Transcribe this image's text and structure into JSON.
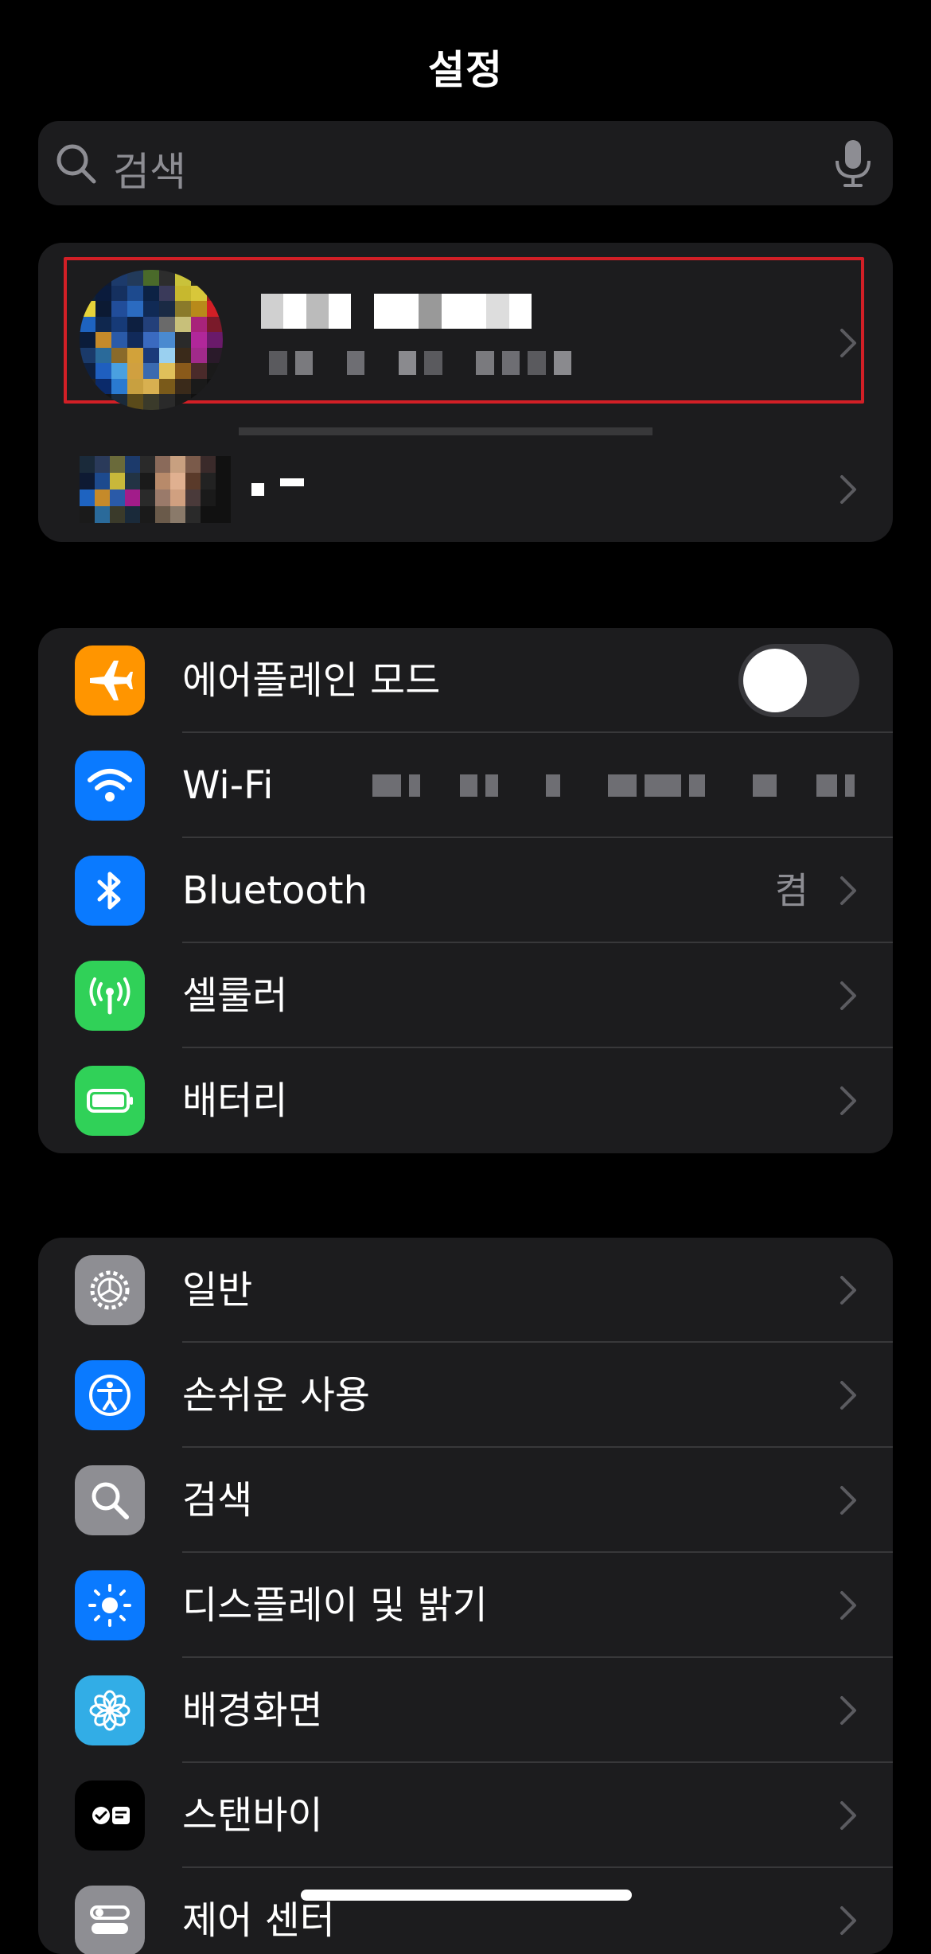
{
  "header": {
    "title": "설정"
  },
  "search": {
    "placeholder": "검색",
    "icons": [
      "search-icon",
      "mic-icon"
    ]
  },
  "account": {
    "primary_name": "",
    "secondary_name": ""
  },
  "connectivity": {
    "items": [
      {
        "label": "에어플레인 모드",
        "icon": "airplane-icon",
        "color": "#ff9500",
        "toggle": false
      },
      {
        "label": "Wi-Fi",
        "icon": "wifi-icon",
        "color": "#0a7aff",
        "value": ""
      },
      {
        "label": "Bluetooth",
        "icon": "bluetooth-icon",
        "color": "#0a7aff",
        "value": "켬"
      },
      {
        "label": "셀룰러",
        "icon": "cellular-icon",
        "color": "#30d158"
      },
      {
        "label": "배터리",
        "icon": "battery-icon",
        "color": "#30d158"
      }
    ]
  },
  "general": {
    "items": [
      {
        "label": "일반",
        "icon": "gear-icon",
        "color": "#8e8e93"
      },
      {
        "label": "손쉬운 사용",
        "icon": "accessibility-icon",
        "color": "#0a7aff"
      },
      {
        "label": "검색",
        "icon": "search-icon",
        "color": "#8e8e93"
      },
      {
        "label": "디스플레이 및 밝기",
        "icon": "brightness-icon",
        "color": "#0a7aff"
      },
      {
        "label": "배경화면",
        "icon": "wallpaper-flower-icon",
        "color": "#32ade6"
      },
      {
        "label": "스탠바이",
        "icon": "standby-icon",
        "color": "#1c1c1e"
      },
      {
        "label": "제어 센터",
        "icon": "control-center-icon",
        "color": "#8e8e93"
      }
    ]
  }
}
